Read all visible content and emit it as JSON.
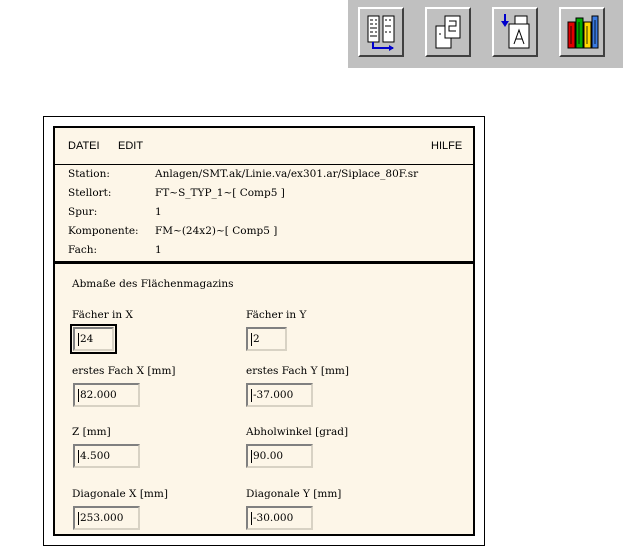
{
  "toolbar": {
    "buttons": [
      {
        "icon": "layout-grid-icon"
      },
      {
        "icon": "copy-documents-icon"
      },
      {
        "icon": "import-document-icon"
      },
      {
        "icon": "color-books-icon"
      }
    ]
  },
  "menu": {
    "datei": "DATEI",
    "edit": "EDIT",
    "hilfe": "HILFE"
  },
  "info": {
    "station_label": "Station:",
    "station_value": "Anlagen/SMT.ak/Linie.va/ex301.ar/Siplace_80F.sr",
    "stellort_label": "Stellort:",
    "stellort_value": "FT~S_TYP_1~[ Comp5 ]",
    "spur_label": "Spur:",
    "spur_value": "1",
    "komponente_label": "Komponente:",
    "komponente_value": "FM~(24x2)~[ Comp5 ]",
    "fach_label": "Fach:",
    "fach_value": "1"
  },
  "form": {
    "title": "Abmaße des Flächenmagazins",
    "faecher_x_label": "Fächer in X",
    "faecher_x_value": "24",
    "faecher_y_label": "Fächer in Y",
    "faecher_y_value": "2",
    "fach_x_label": "erstes Fach X [mm]",
    "fach_x_value": "82.000",
    "fach_y_label": "erstes Fach Y [mm]",
    "fach_y_value": "-37.000",
    "z_label": "Z [mm]",
    "z_value": "4.500",
    "abholwinkel_label": "Abholwinkel [grad]",
    "abholwinkel_value": "90.00",
    "diag_x_label": "Diagonale X [mm]",
    "diag_x_value": "253.000",
    "diag_y_label": "Diagonale Y [mm]",
    "diag_y_value": "-30.000"
  }
}
